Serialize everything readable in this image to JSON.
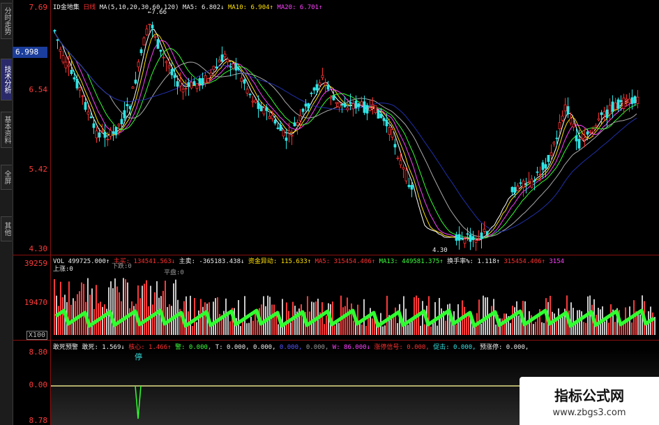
{
  "side_tabs": [
    {
      "label": "分时走势",
      "active": false
    },
    {
      "label": "技术分析",
      "active": true
    },
    {
      "label": "基本资料",
      "active": false
    },
    {
      "label": "全屏",
      "active": false
    },
    {
      "label": "其他",
      "active": false
    }
  ],
  "price_axis": {
    "top": "7.69",
    "current": "6.998",
    "ticks": [
      "6.54",
      "5.42",
      "4.30"
    ]
  },
  "vol_axis": {
    "ticks": [
      "39259",
      "19470"
    ],
    "unit": "X100"
  },
  "ind_axis": {
    "ticks": [
      "8.80",
      "0.00",
      "8.78"
    ]
  },
  "header": {
    "name": "ID金地集",
    "period": "日线",
    "ma_def": "MA(5,10,20,30,60,120)",
    "ma5": "MA5: 6.802↓",
    "ma10": "MA10: 6.904↑",
    "ma20": "MA20: 6.701↑",
    "low_mark": "←7.66",
    "low_bottom": "4.30"
  },
  "vol_bar": {
    "vol": "VOL 499725.000↑",
    "zhumai": "主买: 134541.563↓",
    "zhumai2": "主卖: -365183.438↓",
    "yidong": "资金异动: 115.633↑",
    "ma5": "MA5: 315454.406↑",
    "ma13": "MA13: 449581.375↑",
    "huanshou": "换手率%: 1.118↑",
    "extra1": "315454.406↑",
    "extra2": "3154",
    "row2_a": "上涨:0",
    "row2_b": "下跌:0",
    "row2_c": "平盘:0"
  },
  "ind_bar": {
    "name": "敢死预警",
    "gansi": "敢死: 1.569↓",
    "hexin": "核心: 1.466↑",
    "ting": "警: 0.000,",
    "t": "T: 0.000,",
    "a": "0.000,",
    "b": "0.000,",
    "c": "0.000,",
    "w": "W: 86.000↓",
    "zhangting": "涨停信号: 0.000,",
    "cuzhang": "促击: 0.000,",
    "yujing": "预涨停: 0.000,",
    "stop": "停"
  },
  "watermark": {
    "title": "指标公式网",
    "url": "www.zbgs3.com"
  }
}
